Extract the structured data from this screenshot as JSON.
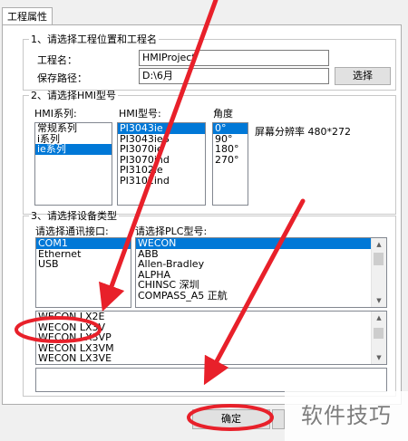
{
  "tab": {
    "label": "工程属性"
  },
  "section1": {
    "title": "1、请选择工程位置和工程名",
    "name_label": "工程名：",
    "name_value": "HMIProject",
    "path_label": "保存路径：",
    "path_value": "D:\\6月",
    "browse_label": "选择"
  },
  "section2": {
    "title": "2、请选择HMI型号",
    "series_label": "HMI系列:",
    "series": [
      "常规系列",
      "i系列",
      "ie系列"
    ],
    "model_label": "HMI型号:",
    "models": [
      "PI3043ie",
      "PI3043ieS",
      "PI3070ie",
      "PI3070ind",
      "PI3102ie",
      "PI3102ind"
    ],
    "angle_label": "角度",
    "angles": [
      "0°",
      "90°",
      "180°",
      "270°"
    ],
    "resolution_label": "屏幕分辨率 480*272"
  },
  "section3": {
    "title": "3、请选择设备类型",
    "port_label": "请选择通讯接口:",
    "ports": [
      "COM1",
      "Ethernet",
      "USB"
    ],
    "plc_label": "请选择PLC型号:",
    "plcs": [
      "WECON",
      "ABB",
      "Allen-Bradley",
      "ALPHA",
      "CHINSC 深圳",
      "COMPASS_A5 正航"
    ],
    "subtypes": [
      "WECON LX2E",
      "WECON LX3V",
      "WECON LX3VP",
      "WECON LX3VM",
      "WECON LX3VE"
    ]
  },
  "footer": {
    "ok_label": "确定"
  },
  "watermark": {
    "text": "软件技巧"
  },
  "colors": {
    "selection": "#0078d7",
    "annotation": "#e8202a"
  }
}
